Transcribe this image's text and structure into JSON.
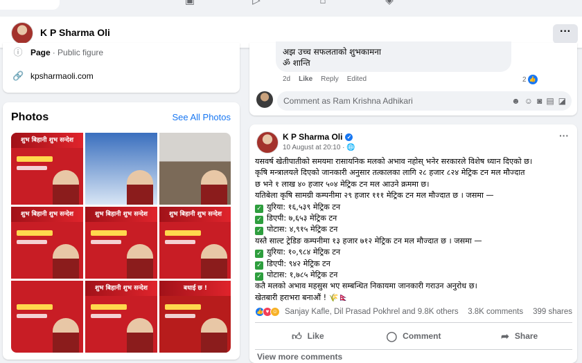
{
  "profile": {
    "name": "K P Sharma Oli",
    "more_label": "···"
  },
  "intro": {
    "page_label": "Page",
    "page_category": "· Public figure",
    "website": "kpsharmaoli.com"
  },
  "photos": {
    "title": "Photos",
    "see_all": "See All Photos",
    "tiles": [
      {
        "banner": "शुभ बिहानी शुभ सन्देश",
        "style": "red"
      },
      {
        "banner": "",
        "style": "blue"
      },
      {
        "banner": "",
        "style": "room"
      },
      {
        "banner": "शुभ बिहानी शुभ सन्देश",
        "style": "red"
      },
      {
        "banner": "शुभ बिहानी शुभ सन्देश",
        "style": "red"
      },
      {
        "banner": "शुभ बिहानी शुभ सन्देश",
        "style": "red"
      },
      {
        "banner": "",
        "style": "red"
      },
      {
        "banner": "शुभ बिहानी शुभ सन्देश",
        "style": "red"
      },
      {
        "banner": "बधाई छ !",
        "style": "dark"
      }
    ]
  },
  "comment_snippet": {
    "line1": "अझ उच्च सफलताको शुभकामना",
    "line2": "ॐ शान्ति",
    "time": "2d",
    "like": "Like",
    "reply": "Reply",
    "edited": "Edited",
    "reaction_count": "2",
    "input_placeholder": "Comment as Ram Krishna Adhikari"
  },
  "post": {
    "author": "K P Sharma Oli",
    "date": "10 August at 20:10 · ",
    "body": [
      "यसवर्ष खेतीपातीको समयमा रासायनिक मलको अभाव नहोस् भनेर सरकारले विशेष ध्यान दिएको छ।",
      "कृषि मन्त्रालयले दिएको जानकारी अनुसार तत्कालका लागि २८ हजार ८२४ मेट्रिक टन मल मौज्दात",
      "छ भने १ लाख ४० हजार ५०४ मेट्रिक टन मल आउने क्रममा छ।",
      "यतिबेला कृषि सामग्री कम्पनीमा २९ हजार १११ मेट्रिक टन मल मौज्दात छ । जसमा —"
    ],
    "list1": [
      "युरिया: १६,५३९ मेट्रिक टन",
      "डिएपी: ७,६५३ मेट्रिक टन",
      "पोटास: ४,९१५ मेट्रिक टन"
    ],
    "mid_line": "यस्तै साल्ट ट्रेडिङ कम्पनीमा १३ हजार ७१२ मेट्रिक टन मल मौज्दात छ । जसमा —",
    "list2": [
      "युरिया: १०,९८४ मेट्रिक टन",
      "डिएपी: ९४२ मेट्रिक टन",
      "पोटास: १,७८५ मेट्रिक टन"
    ],
    "end_line1": "कतै मलको अभाव महसुस भए सम्बन्धित निकायमा जानकारी गराउन अनुरोध छ।",
    "end_line2": "खेतबारी हराभरा बनाऔं ! 🌾🇳🇵",
    "reacted_by": "Sanjay Kafle, Dil Prasad Pokhrel and 9.8K others",
    "comments_count": "3.8K comments",
    "shares_count": "399 shares",
    "like_label": "Like",
    "comment_label": "Comment",
    "share_label": "Share",
    "view_more": "View more comments"
  },
  "colors": {
    "accent": "#1877f2",
    "brand_red": "#c81d25",
    "check_green": "#2e9e3e"
  }
}
